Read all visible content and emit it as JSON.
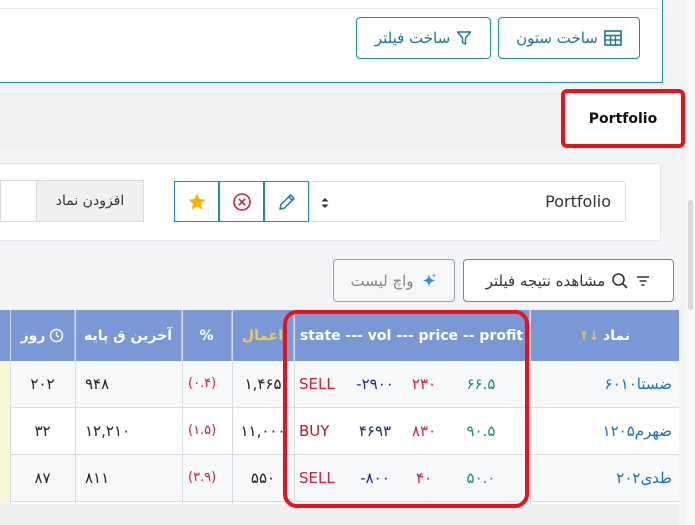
{
  "top_toolbar": {
    "build_column_label": "ساخت ستون",
    "build_filter_label": "ساخت فیلتر"
  },
  "tabs": {
    "active_label": "Portfolio"
  },
  "portfolio_toolbar": {
    "add_symbol_label": "افزودن نماد",
    "selected_portfolio": "Portfolio"
  },
  "actions": {
    "view_filter_result_label": "مشاهده نتیجه فیلتر",
    "watchlist_label": "واچ لیست"
  },
  "table": {
    "headers": {
      "symbol": "نماد",
      "sort_arrows": "↓↑",
      "state_summary": "state --- vol --- price -- profit",
      "commit": "اعمال",
      "percent": "%",
      "last_base_price": "آخرین ق پایه",
      "day": "روز"
    },
    "rows": [
      {
        "symbol": "ضستا۶۰۱۰",
        "profit": "۶۶.۵",
        "price": "۲۳۰",
        "vol": "-۲۹۰۰",
        "state": "SELL",
        "commit": "۱,۴۶۵",
        "percent": "(۰.۴)",
        "last_base": "۹۴۸",
        "day": "۲۰۲"
      },
      {
        "symbol": "ضهرم۱۲۰۵",
        "profit": "۹۰.۵",
        "price": "۸۳۰",
        "vol": "۴۶۹۳",
        "state": "BUY",
        "commit": "۱۱,۰۰۰",
        "percent": "(۱.۵)",
        "last_base": "۱۲,۲۱۰",
        "day": "۳۲"
      },
      {
        "symbol": "طدی۲۰۲",
        "profit": "۵۰.۰",
        "price": "۴۰",
        "vol": "-۸۰۰",
        "state": "SELL",
        "commit": "۵۵۰",
        "percent": "(۳.۹)",
        "last_base": "۸۱۱",
        "day": "۸۷"
      }
    ]
  },
  "colors": {
    "accent": "#17798c",
    "header_bg": "#7b98d6",
    "highlight": "#e8121a",
    "sell": "#d0213a",
    "buy": "#b8172b",
    "vol": "#1c2a7c",
    "profit": "#12907f",
    "symbol_link": "#1a6fc4",
    "commit_header": "#f2c94c"
  },
  "icons": {
    "table_icon": "table-grid-icon",
    "funnel_icon": "funnel-icon",
    "star_icon": "star-icon",
    "remove_icon": "circle-x-icon",
    "edit_icon": "pencil-icon",
    "sparkle_icon": "sparkle-icon",
    "search_icon": "search-icon",
    "filter_lines_icon": "filter-lines-icon",
    "clock_icon": "clock-icon"
  }
}
